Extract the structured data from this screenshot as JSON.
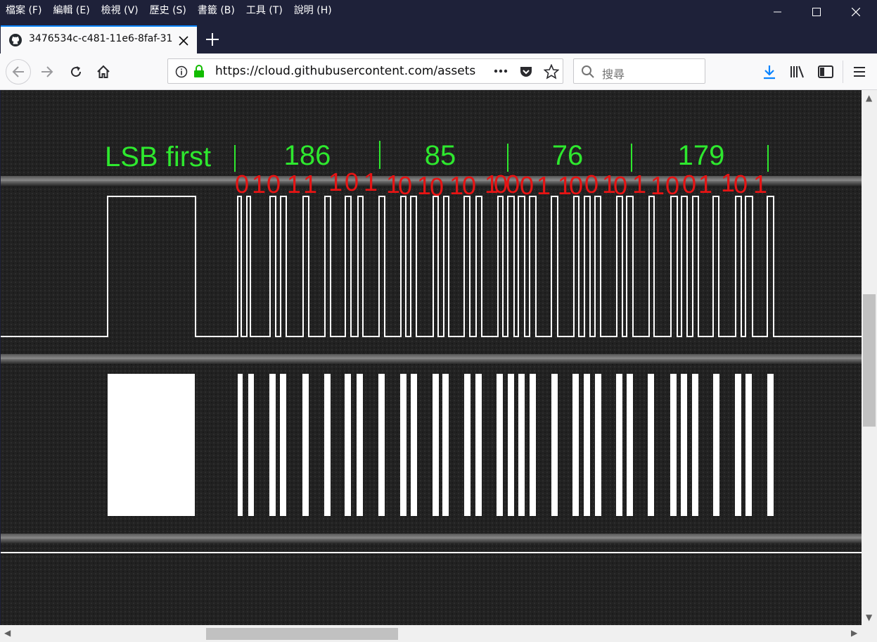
{
  "menu": {
    "items": [
      "檔案 (F)",
      "編輯 (E)",
      "檢視 (V)",
      "歷史 (S)",
      "書籤 (B)",
      "工具 (T)",
      "說明 (H)"
    ]
  },
  "tab": {
    "title": "3476534c-c481-11e6-8faf-31"
  },
  "url": {
    "text": "https://cloud.githubusercontent.com/assets"
  },
  "search": {
    "placeholder": "搜尋"
  },
  "icons": {
    "tab_icon": "github-icon",
    "close": "close-icon",
    "new_tab": "plus-icon",
    "back": "back-arrow-icon",
    "forward": "forward-arrow-icon",
    "reload": "reload-icon",
    "home": "home-icon",
    "info": "info-icon",
    "lock": "lock-icon",
    "more": "more-dots-icon",
    "pocket": "pocket-icon",
    "bookmark": "star-icon",
    "search": "search-icon",
    "download": "download-icon",
    "library": "library-icon",
    "sidebar": "sidebar-icon",
    "menu": "hamburger-menu-icon"
  },
  "colors": {
    "label_green": "#2ee82e",
    "bit_red": "#e61414",
    "accent": "#0a84ff"
  },
  "image": {
    "heading": "LSB first",
    "bytes": [
      "186",
      "85",
      "76",
      "179"
    ],
    "bit_labels": [
      {
        "t": "0"
      },
      {
        "t": "1"
      },
      {
        "t": "0"
      },
      {
        "t": "1"
      },
      {
        "t": "1"
      },
      {
        "t": "1"
      },
      {
        "t": "0"
      },
      {
        "t": "1"
      },
      {
        "t": "1"
      },
      {
        "t": "0"
      },
      {
        "t": "1"
      },
      {
        "t": "0"
      },
      {
        "t": "1"
      },
      {
        "t": "0"
      },
      {
        "t": "1"
      },
      {
        "t": "0"
      },
      {
        "t": "0"
      },
      {
        "t": "0"
      },
      {
        "t": "1"
      },
      {
        "t": "1"
      },
      {
        "t": "0"
      },
      {
        "t": "0"
      },
      {
        "t": "1"
      },
      {
        "t": "0"
      },
      {
        "t": "1"
      },
      {
        "t": "1"
      },
      {
        "t": "0"
      },
      {
        "t": "0"
      },
      {
        "t": "1"
      },
      {
        "t": "1"
      },
      {
        "t": "0"
      },
      {
        "t": "1"
      }
    ]
  }
}
